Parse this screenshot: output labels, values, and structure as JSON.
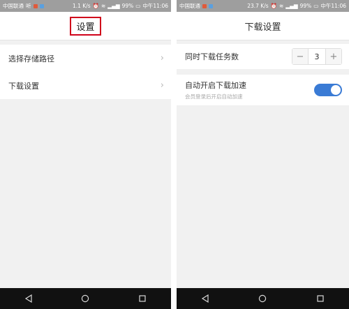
{
  "left": {
    "status": {
      "carrier": "中国联通",
      "extra": "听",
      "speed": "1.1 K/s",
      "battery": "99%",
      "time": "中午11:06"
    },
    "title": "设置",
    "rows": [
      {
        "label": "选择存储路径"
      },
      {
        "label": "下载设置"
      }
    ]
  },
  "right": {
    "status": {
      "carrier": "中国联通",
      "speed": "23.7 K/s",
      "battery": "99%",
      "time": "中午11:06"
    },
    "title": "下载设置",
    "concurrent": {
      "label": "同时下载任务数",
      "minus": "−",
      "value": "3",
      "plus": "+"
    },
    "accelerate": {
      "label": "自动开启下载加速",
      "hint": "会员登录后开启自动加速",
      "enabled": true
    }
  },
  "colors": {
    "highlight_box": "#d0021b",
    "toggle_on": "#3a7bd5",
    "status_bar": "#9e9e9e",
    "nav_bar": "#111111"
  },
  "icons": {
    "nav": [
      "back-triangle-icon",
      "home-circle-icon",
      "recents-square-icon"
    ]
  }
}
